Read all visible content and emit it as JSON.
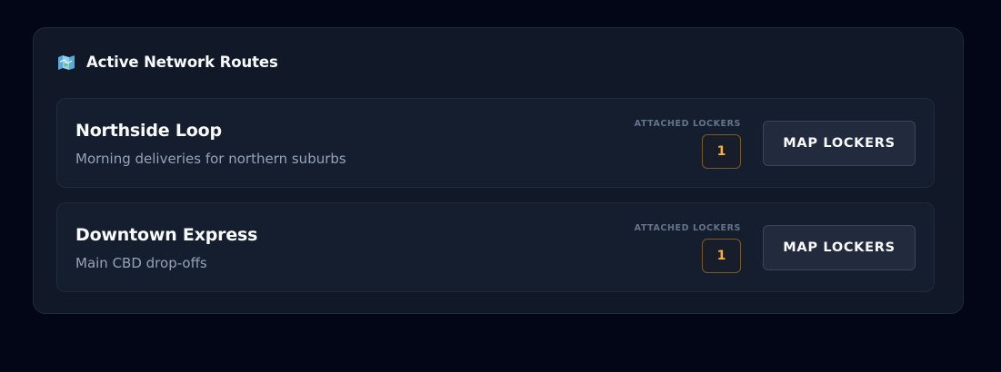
{
  "panel": {
    "title": "Active Network Routes",
    "icon": "map-icon"
  },
  "routes": [
    {
      "name": "Northside Loop",
      "description": "Morning deliveries for northern suburbs",
      "lockers_label": "ATTACHED LOCKERS",
      "lockers_count": "1",
      "button_label": "MAP LOCKERS"
    },
    {
      "name": "Downtown Express",
      "description": "Main CBD drop-offs",
      "lockers_label": "ATTACHED LOCKERS",
      "lockers_count": "1",
      "button_label": "MAP LOCKERS"
    }
  ],
  "colors": {
    "background": "#020617",
    "panel": "#111827",
    "card": "#151e2f",
    "accent": "#f5b13d",
    "muted_text": "#94a3b8"
  }
}
